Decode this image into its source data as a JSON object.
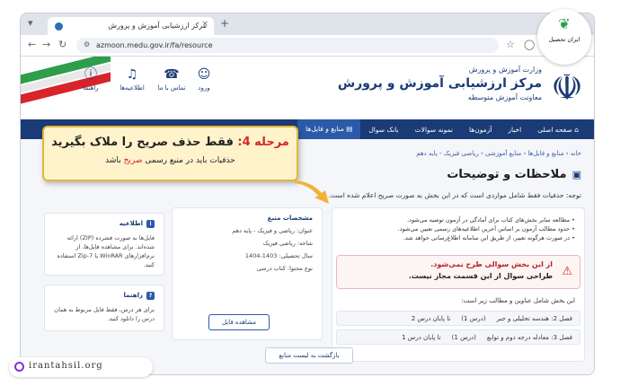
{
  "browser": {
    "tab_title": "مرکز ارزشیابی آموزش و پرورش",
    "url": "azmoon.medu.gov.ir/fa/resource"
  },
  "header": {
    "org_line1": "وزارت آموزش و پرورش",
    "org_title": "مرکز ارزشیابی آموزش و پرورش",
    "org_line3": "معاونت آموزش متوسطه",
    "icons": [
      {
        "label": "ورود",
        "icon": "user-icon"
      },
      {
        "label": "تماس با ما",
        "icon": "contact-icon"
      },
      {
        "label": "اطلاعیه‌ها",
        "icon": "bell-icon"
      },
      {
        "label": "راهنما",
        "icon": "help-icon"
      }
    ]
  },
  "nav": {
    "items": [
      "صفحه اصلی",
      "اخبار",
      "آزمون‌ها",
      "نمونه سوالات",
      "بانک سوال",
      "منابع و فایل‌ها"
    ]
  },
  "breadcrumb": "خانه  ›  منابع و فایل‌ها  ›  منابع آموزشی  ›  ریاضی فیزیک - پایه دهم",
  "main": {
    "title": "ملاحظات و توضیحات",
    "note": "توجه: حذفیات فقط شامل مواردی است که در این بخش به صورت صریح اعلام شده است.",
    "bullets": [
      "مطالعه سایر بخش‌های کتاب برای آمادگی در آزمون توصیه می‌شود.",
      "حدود مطالب آزمون بر اساس آخرین اطلاعیه‌های رسمی تعیین می‌شود.",
      "در صورت هرگونه تغییر، از طریق این سامانه اطلاع‌رسانی خواهد شد."
    ],
    "warning_line1": "از این بخش سوالی طرح نمی‌شود.",
    "warning_line2": "طراحی سوال از این قسمت مجاز نیست.",
    "subhead": "این بخش شامل عناوین و مطالب زیر است:",
    "rows": [
      {
        "chapter": "فصل 2: هندسه تحلیلی و جبر",
        "from": "(درس 1)",
        "to": "تا پایان درس 2"
      },
      {
        "chapter": "فصل 3: معادله درجه دوم و توابع",
        "from": "(درس 1)",
        "to": "تا پایان درس 1"
      }
    ]
  },
  "specs": {
    "title": "مشخصات منبع",
    "lines": [
      "عنوان: ریاضی و فیزیک - پایه دهم",
      "شاخه: ریاضی فیزیک",
      "سال تحصیلی: 1403-1404",
      "نوع محتوا: کتاب درسی"
    ],
    "button": "مشاهده فایل"
  },
  "notice": {
    "title": "اطلاعیه",
    "text": "فایل‌ها به صورت فشرده (ZIP) ارائه شده‌اند. برای مشاهده فایل‌ها، از نرم‌افزارهای WinRAR یا 7-Zip استفاده کنید."
  },
  "guide": {
    "title": "راهنما",
    "text": "برای هر درس، فقط فایل مربوط به همان درس را دانلود کنید."
  },
  "back_button": "بازگشت به لیست منابع",
  "callout": {
    "step": "مرحله 4:",
    "headline": "فقط حذف صریح  را ملاک بگیرید",
    "line2_a": "حذفیات باید در منبع رسمی",
    "line2_em": "صریح",
    "line2_b": "باشد"
  },
  "watermark": {
    "brand": "ایران تحصیل",
    "site": "irantahsil.org"
  },
  "colors": {
    "nav": "#1a3b75",
    "accent": "#2b5aa8",
    "warning": "#d42626",
    "callout_bg": "#fff3cc",
    "arrow": "#f2b233"
  }
}
